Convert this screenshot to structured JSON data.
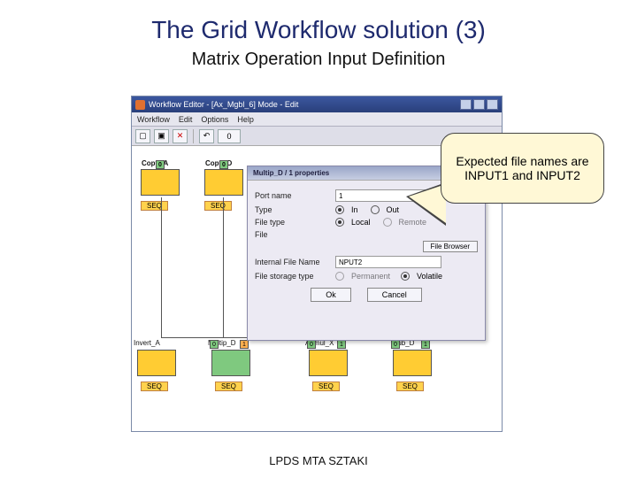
{
  "slide": {
    "title": "The Grid Workflow solution (3)",
    "subtitle": "Matrix Operation Input Definition",
    "footer": "LPDS MTA SZTAKI"
  },
  "window": {
    "title": "Workflow Editor - [Ax_Mgbl_6] Mode - Edit",
    "menu": [
      "Workflow",
      "Edit",
      "Options",
      "Help"
    ]
  },
  "toolbar": {
    "icons": [
      "new",
      "open",
      "delete",
      "sep",
      "undo",
      "redo",
      "sep",
      "run"
    ],
    "zoom_value": "0"
  },
  "canvas": {
    "nodes": {
      "copy_a": {
        "label": "Copy_A",
        "seq": "SEQ"
      },
      "copy_d": {
        "label": "Copy_D",
        "seq": "SEQ"
      },
      "invert_a": {
        "label": "Invert_A",
        "seq": "SEQ"
      },
      "multip_d": {
        "label": "Multip_D",
        "seq": "SEQ"
      },
      "a_mul_x": {
        "label": "A_mul_X",
        "seq": "SEQ"
      },
      "sub_d": {
        "label": "Sub_D",
        "seq": "SEQ"
      }
    },
    "port_labels": {
      "p0": "0",
      "p1": "1"
    }
  },
  "dialog": {
    "title": "Multip_D / 1 properties",
    "labels": {
      "port_name": "Port name",
      "type": "Type",
      "file_type": "File type",
      "file": "File",
      "internal": "Internal File Name",
      "storage": "File storage type"
    },
    "values": {
      "port_name": "1",
      "type_in": "In",
      "type_out": "Out",
      "ft_local": "Local",
      "ft_remote": "Remote",
      "internal": "NPUT2",
      "st_permanent": "Permanent",
      "st_volatile": "Volatile",
      "file_browser": "File Browser",
      "ok": "Ok",
      "cancel": "Cancel"
    }
  },
  "callout": {
    "text": "Expected file names are INPUT1 and INPUT2"
  }
}
